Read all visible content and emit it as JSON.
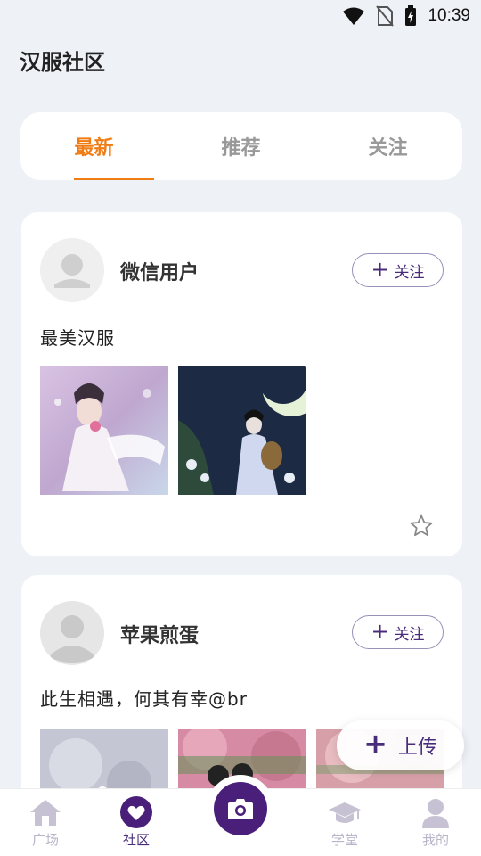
{
  "status_bar": {
    "time": "10:39"
  },
  "app": {
    "title": "汉服社区"
  },
  "tabs": [
    {
      "label": "最新",
      "active": true
    },
    {
      "label": "推荐",
      "active": false
    },
    {
      "label": "关注",
      "active": false
    }
  ],
  "posts": [
    {
      "username": "微信用户",
      "follow_label": "关注",
      "text": "最美汉服",
      "image_count": 2
    },
    {
      "username": "苹果煎蛋",
      "follow_label": "关注",
      "text": "此生相遇，何其有幸@br",
      "image_count": 3
    }
  ],
  "upload": {
    "label": "上传"
  },
  "bottom_nav": [
    {
      "label": "广场",
      "icon": "home-icon",
      "active": false
    },
    {
      "label": "社区",
      "icon": "heart-icon",
      "active": true
    },
    {
      "label": "学堂",
      "icon": "graduation-cap-icon",
      "active": false
    },
    {
      "label": "我的",
      "icon": "user-icon",
      "active": false
    }
  ],
  "colors": {
    "accent": "#f07c14",
    "brand": "#4a1f7a",
    "inactive": "#b9b4c8"
  }
}
